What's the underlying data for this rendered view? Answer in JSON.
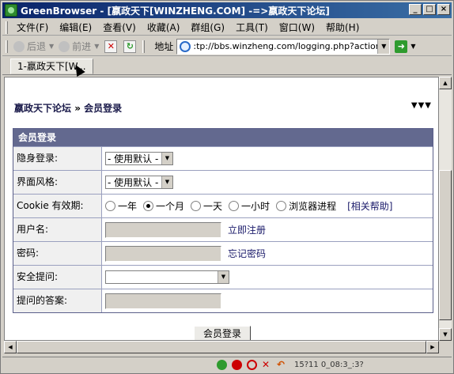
{
  "window": {
    "title": "GreenBrowser - [嬴政天下[WINZHENG.COM] -=>嬴政天下论坛]",
    "controls": [
      "_",
      "□",
      "×"
    ]
  },
  "menu": [
    "文件(F)",
    "编辑(E)",
    "查看(V)",
    "收藏(A)",
    "群组(G)",
    "工具(T)",
    "窗口(W)",
    "帮助(H)"
  ],
  "toolbar": {
    "back": "后退",
    "forward": "前进",
    "address_label": "地址",
    "address_value": ":tp://bbs.winzheng.com/logging.php?action=login"
  },
  "tabs": [
    {
      "label": "1-嬴政天下[W..."
    }
  ],
  "page": {
    "breadcrumb": {
      "site": "嬴政天下论坛",
      "sep": " » ",
      "current": "会员登录"
    },
    "arrows": "▼▼▼",
    "form_title": "会员登录",
    "rows": {
      "invisible": {
        "label": "隐身登录:",
        "value": "- 使用默认 -"
      },
      "style": {
        "label": "界面风格:",
        "value": "- 使用默认 -"
      },
      "cookie": {
        "label": "Cookie 有效期:",
        "options": [
          "一年",
          "一个月",
          "一天",
          "一小时",
          "浏览器进程"
        ],
        "selected": "一个月",
        "help": "[相关帮助]"
      },
      "username": {
        "label": "用户名:",
        "value": "",
        "link": "立即注册"
      },
      "password": {
        "label": "密码:",
        "value": "",
        "link": "忘记密码"
      },
      "question": {
        "label": "安全提问:",
        "value": ""
      },
      "answer": {
        "label": "提问的答案:",
        "value": ""
      }
    },
    "submit": "会员登录"
  },
  "status": {
    "clock": "15?11 0_08:3_:3?"
  }
}
